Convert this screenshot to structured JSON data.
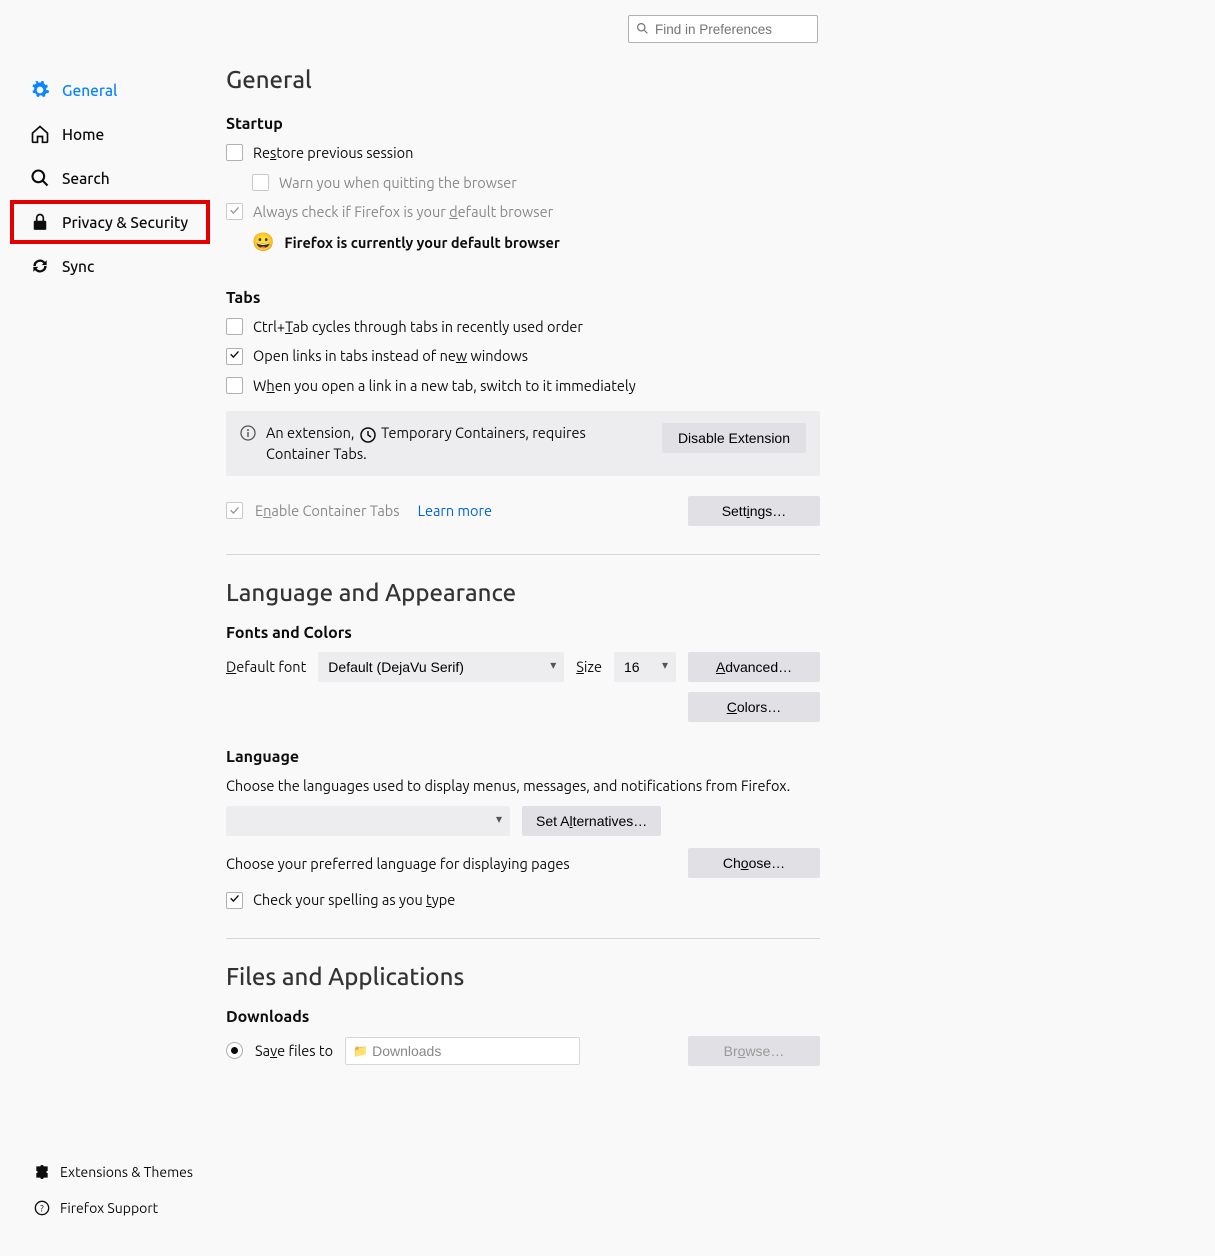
{
  "search": {
    "placeholder": "Find in Preferences"
  },
  "sidebar": {
    "items": [
      {
        "label": "General"
      },
      {
        "label": "Home"
      },
      {
        "label": "Search"
      },
      {
        "label": "Privacy & Security"
      },
      {
        "label": "Sync"
      }
    ],
    "bottom": [
      {
        "label": "Extensions & Themes"
      },
      {
        "label": "Firefox Support"
      }
    ]
  },
  "page": {
    "title": "General",
    "startup": {
      "heading": "Startup",
      "restore": "Restore previous session",
      "warn": "Warn you when quitting the browser",
      "always_check": "Always check if Firefox is your default browser",
      "default_status": "Firefox is currently your default browser"
    },
    "tabs": {
      "heading": "Tabs",
      "ctrl_tab": "Ctrl+Tab cycles through tabs in recently used order",
      "open_links": "Open links in tabs instead of new windows",
      "switch_on_open": "When you open a link in a new tab, switch to it immediately",
      "ext_notice_pre": "An extension, ",
      "ext_name": "Temporary Containers",
      "ext_notice_post": ", requires Container Tabs.",
      "disable_ext_btn": "Disable Extension",
      "enable_container": "Enable Container Tabs",
      "learn_more": "Learn more",
      "settings_btn": "Settings…"
    },
    "lang_app": {
      "heading": "Language and Appearance",
      "fonts_heading": "Fonts and Colors",
      "default_font_label": "Default font",
      "default_font_value": "Default (DejaVu Serif)",
      "size_label": "Size",
      "size_value": "16",
      "advanced_btn": "Advanced…",
      "colors_btn": "Colors…",
      "lang_heading": "Language",
      "lang_desc": "Choose the languages used to display menus, messages, and notifications from Firefox.",
      "set_alt_btn": "Set Alternatives…",
      "pages_desc": "Choose your preferred language for displaying pages",
      "choose_btn": "Choose…",
      "spellcheck": "Check your spelling as you type"
    },
    "files": {
      "heading": "Files and Applications",
      "downloads_heading": "Downloads",
      "save_to": "Save files to",
      "save_path": "Downloads",
      "browse_btn": "Browse…"
    }
  }
}
